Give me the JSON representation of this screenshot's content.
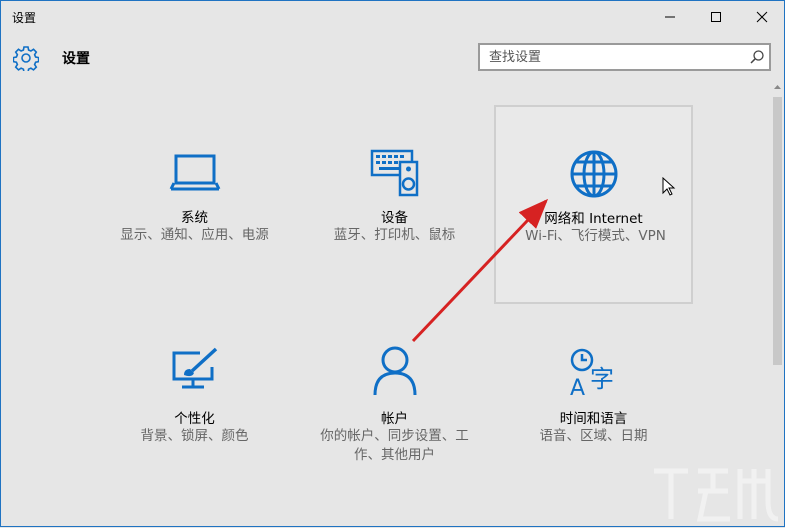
{
  "window": {
    "title": "设置",
    "controls": {
      "minimize_icon": "minimize-icon",
      "maximize_icon": "maximize-icon",
      "close_icon": "close-icon"
    }
  },
  "header": {
    "title": "设置",
    "icon": "gear-icon"
  },
  "search": {
    "placeholder": "查找设置",
    "icon": "search-icon"
  },
  "tiles": [
    {
      "name": "系统",
      "desc": "显示、通知、应用、电源",
      "icon": "laptop-icon"
    },
    {
      "name": "设备",
      "desc": "蓝牙、打印机、鼠标",
      "icon": "keyboard-speaker-icon"
    },
    {
      "name": "网络和 Internet",
      "desc": "Wi-Fi、飞行模式、VPN",
      "icon": "globe-icon"
    },
    {
      "name": "个性化",
      "desc": "背景、锁屏、颜色",
      "icon": "paint-monitor-icon"
    },
    {
      "name": "帐户",
      "desc": "你的帐户、同步设置、工作、其他用户",
      "icon": "person-icon"
    },
    {
      "name": "时间和语言",
      "desc": "语音、区域、日期",
      "icon": "clock-language-icon"
    }
  ],
  "colors": {
    "accent": "#0f6fc6",
    "annotation_arrow": "#d62222",
    "window_border": "#1f73c2"
  }
}
